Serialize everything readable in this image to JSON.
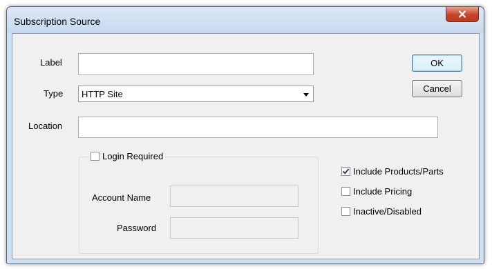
{
  "window": {
    "title": "Subscription Source",
    "close_icon": "close-icon"
  },
  "form": {
    "label_label": "Label",
    "label_value": "",
    "type_label": "Type",
    "type_value": "HTTP Site",
    "location_label": "Location",
    "location_value": ""
  },
  "buttons": {
    "ok": "OK",
    "cancel": "Cancel"
  },
  "login": {
    "checkbox_label": "Login Required",
    "checked": false,
    "account_label": "Account Name",
    "account_value": "",
    "password_label": "Password",
    "password_value": ""
  },
  "options": [
    {
      "label": "Include Products/Parts",
      "checked": true
    },
    {
      "label": "Include Pricing",
      "checked": false
    },
    {
      "label": "Inactive/Disabled",
      "checked": false
    }
  ]
}
